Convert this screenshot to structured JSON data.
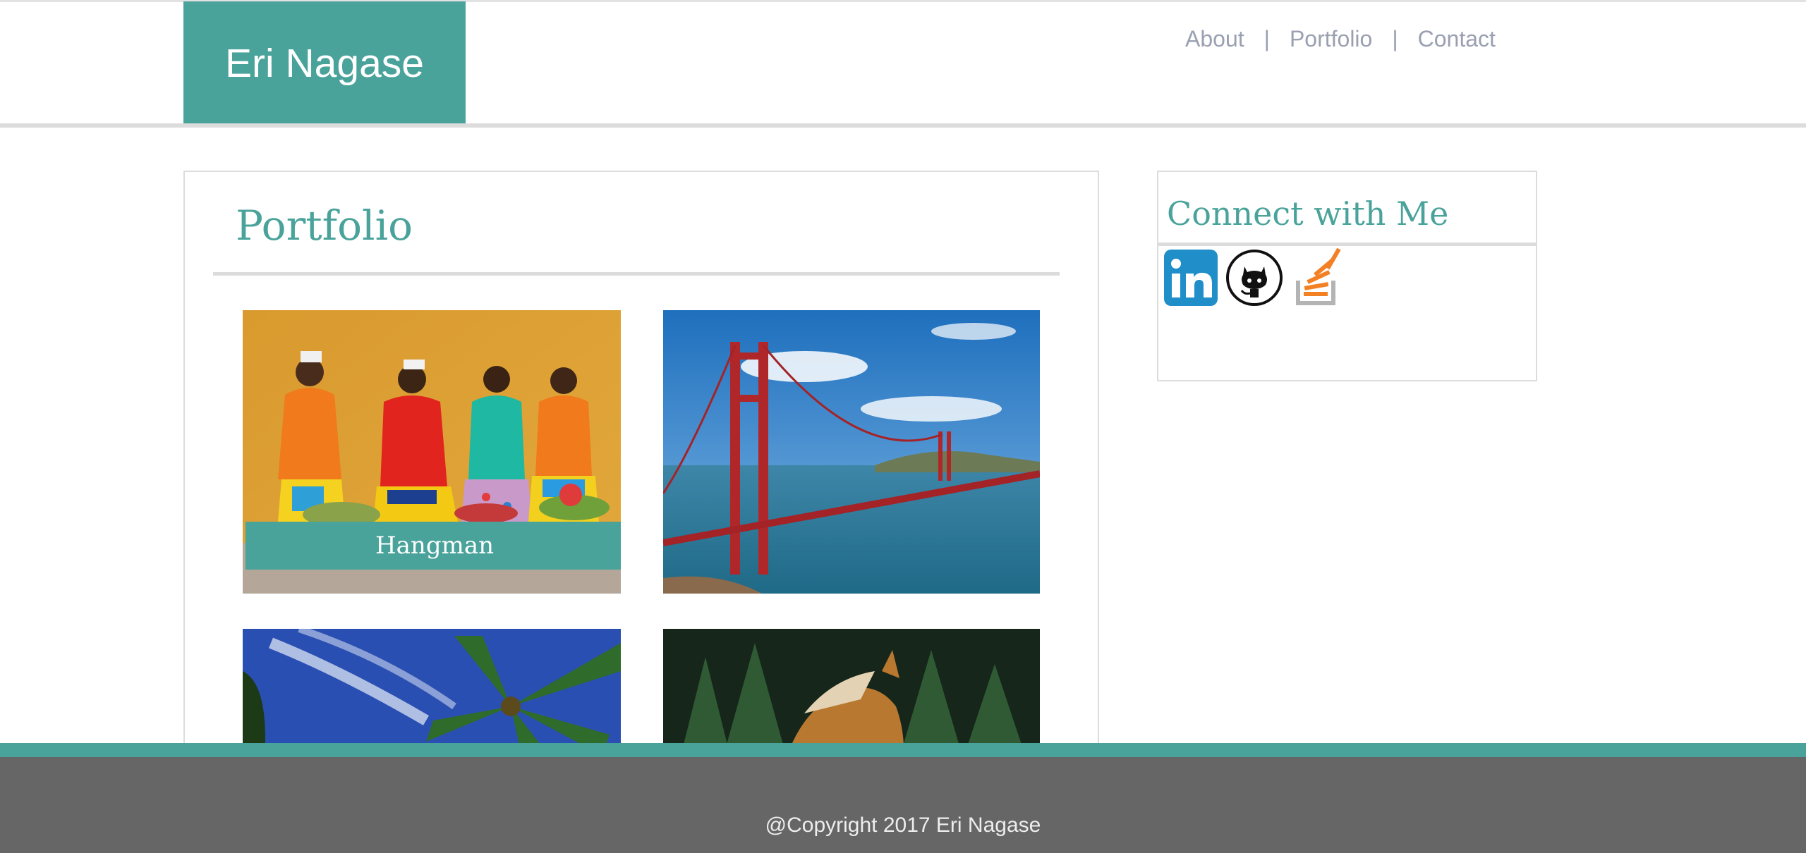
{
  "header": {
    "logo_text": "Eri Nagase",
    "nav": [
      {
        "label": "About"
      },
      {
        "label": "Portfolio"
      },
      {
        "label": "Contact"
      }
    ],
    "separator": "|"
  },
  "portfolio": {
    "title": "Portfolio",
    "items": [
      {
        "caption": "Hangman",
        "image": "women-fruit-photo"
      },
      {
        "caption": "",
        "image": "golden-gate-bridge-photo"
      },
      {
        "caption": "",
        "image": "palm-tree-sky-photo"
      },
      {
        "caption": "",
        "image": "horse-forest-photo"
      }
    ]
  },
  "connect": {
    "title": "Connect with Me",
    "links": [
      {
        "icon": "linkedin-icon"
      },
      {
        "icon": "github-icon"
      },
      {
        "icon": "stackoverflow-icon"
      }
    ]
  },
  "footer": {
    "text": "@Copyright 2017 Eri Nagase"
  },
  "colors": {
    "accent": "#4aa39b",
    "nav_text": "#9aa0b1",
    "footer_bg": "#666666"
  }
}
